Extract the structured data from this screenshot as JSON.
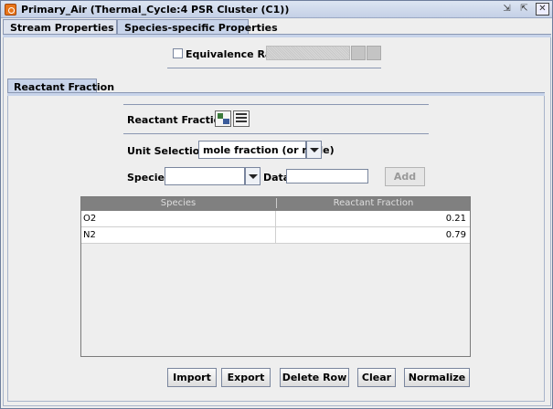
{
  "window": {
    "title": "Primary_Air  (Thermal_Cycle:4 PSR Cluster (C1))",
    "controls": {
      "minimize": "⇲",
      "maximize": "⇱",
      "close": "✕"
    }
  },
  "tabs": [
    {
      "label": "Stream Properties Data",
      "selected": false
    },
    {
      "label": "Species-specific Properties",
      "selected": true
    }
  ],
  "equivalence": {
    "label": "Equivalence Ratio",
    "checked": false,
    "value": ""
  },
  "inner_tab": {
    "label": "Reactant Fraction"
  },
  "reactant_fraction": {
    "label": "Reactant Fraction",
    "icons": [
      "add-rows-icon",
      "table-icon"
    ]
  },
  "unit": {
    "label": "Unit Selection:",
    "selected": "mole fraction (or mole)"
  },
  "species_entry": {
    "label": "Species",
    "selected": "",
    "data_label": "Data",
    "data_value": "",
    "add_label": "Add"
  },
  "table": {
    "columns": [
      "Species",
      "Reactant Fraction"
    ],
    "rows": [
      {
        "species": "O2",
        "fraction": "0.21"
      },
      {
        "species": "N2",
        "fraction": "0.79"
      }
    ]
  },
  "buttons": {
    "import": "Import",
    "export": "Export",
    "delete_row": "Delete Row",
    "clear": "Clear",
    "normalize": "Normalize"
  },
  "colors": {
    "tab_active": "#c8d4ea",
    "header_gray": "#808080",
    "app_icon": "#e8751a"
  }
}
